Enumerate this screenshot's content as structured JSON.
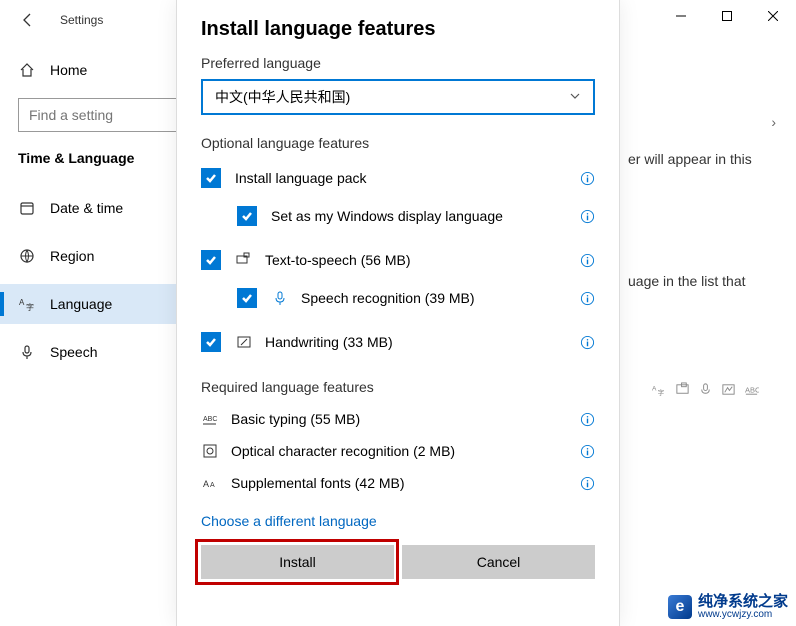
{
  "window": {
    "title": "Settings",
    "minimize": "−",
    "maximize": "□",
    "close": "✕"
  },
  "sidebar": {
    "home_label": "Home",
    "search_placeholder": "Find a setting",
    "section": "Time & Language",
    "items": [
      {
        "label": "Date & time"
      },
      {
        "label": "Region"
      },
      {
        "label": "Language"
      },
      {
        "label": "Speech"
      }
    ]
  },
  "backdrop": {
    "partial1": "er will appear in this",
    "partial2": "uage in the list that",
    "chev": "›"
  },
  "dialog": {
    "title": "Install language features",
    "preferred_label": "Preferred language",
    "preferred_value": "中文(中华人民共和国)",
    "optional_header": "Optional language features",
    "features": {
      "lang_pack": "Install language pack",
      "display_lang": "Set as my Windows display language",
      "tts": "Text-to-speech (56 MB)",
      "speech_rec": "Speech recognition (39 MB)",
      "handwriting": "Handwriting (33 MB)"
    },
    "required_header": "Required language features",
    "required": {
      "basic_typing": "Basic typing (55 MB)",
      "ocr": "Optical character recognition (2 MB)",
      "fonts": "Supplemental fonts (42 MB)"
    },
    "choose_link": "Choose a different language",
    "install_btn": "Install",
    "cancel_btn": "Cancel"
  },
  "watermark": {
    "name": "纯净系统之家",
    "url": "www.ycwjzy.com"
  }
}
